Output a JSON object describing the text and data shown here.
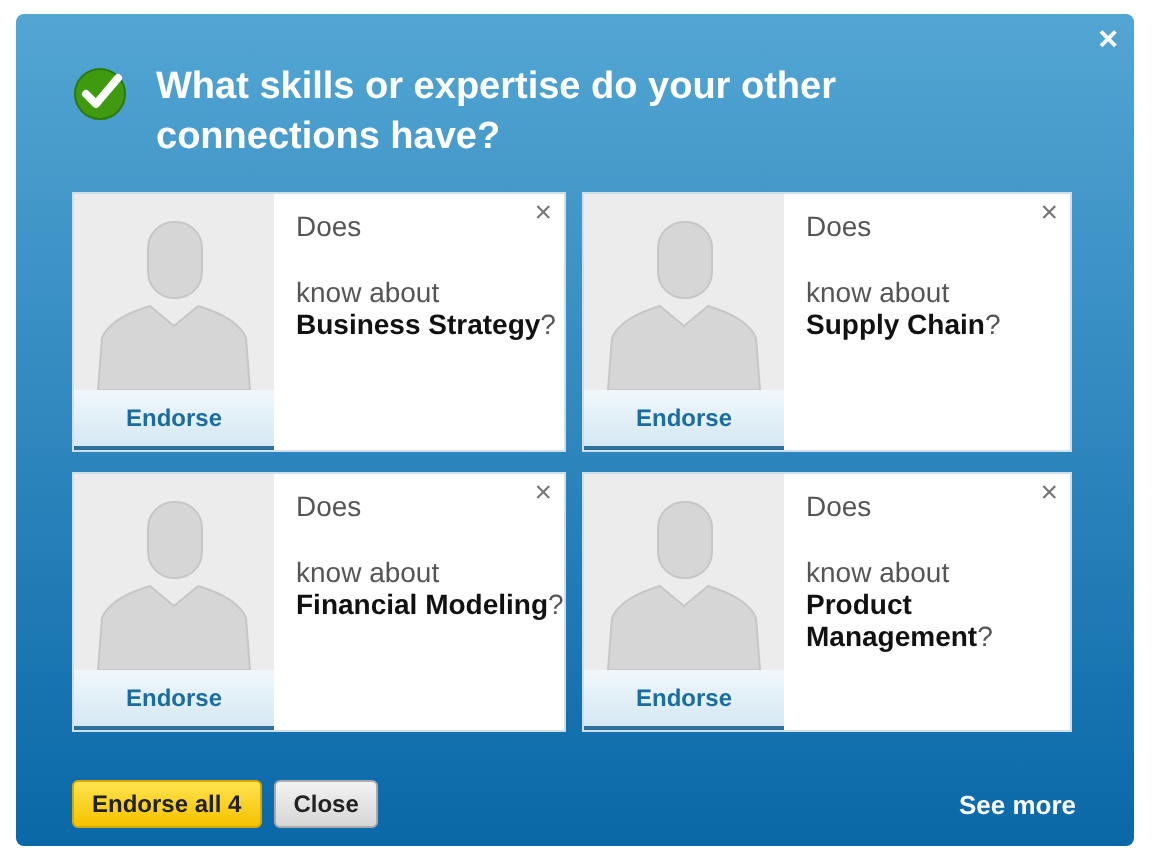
{
  "dialog": {
    "title": "What skills or expertise do your other connections have?",
    "close": "×"
  },
  "cards": [
    {
      "question": "Does",
      "prompt": "know about",
      "skill": "**Business Strategy**?",
      "button": "Endorse",
      "dismiss": "×"
    },
    {
      "question": "Does",
      "prompt": "know about",
      "skill": "**Supply Chain**?",
      "button": "Endorse",
      "dismiss": "×"
    },
    {
      "question": "Does",
      "prompt": "know about",
      "skill": "**Financial Modeling**?",
      "button": "Endorse",
      "dismiss": "×"
    },
    {
      "question": "Does",
      "prompt": "know about",
      "skill": "**Product Management**?",
      "button": "Endorse",
      "dismiss": "×"
    }
  ],
  "footer": {
    "primary": "Endorse all 4",
    "secondary": "Close",
    "link": "See more"
  }
}
